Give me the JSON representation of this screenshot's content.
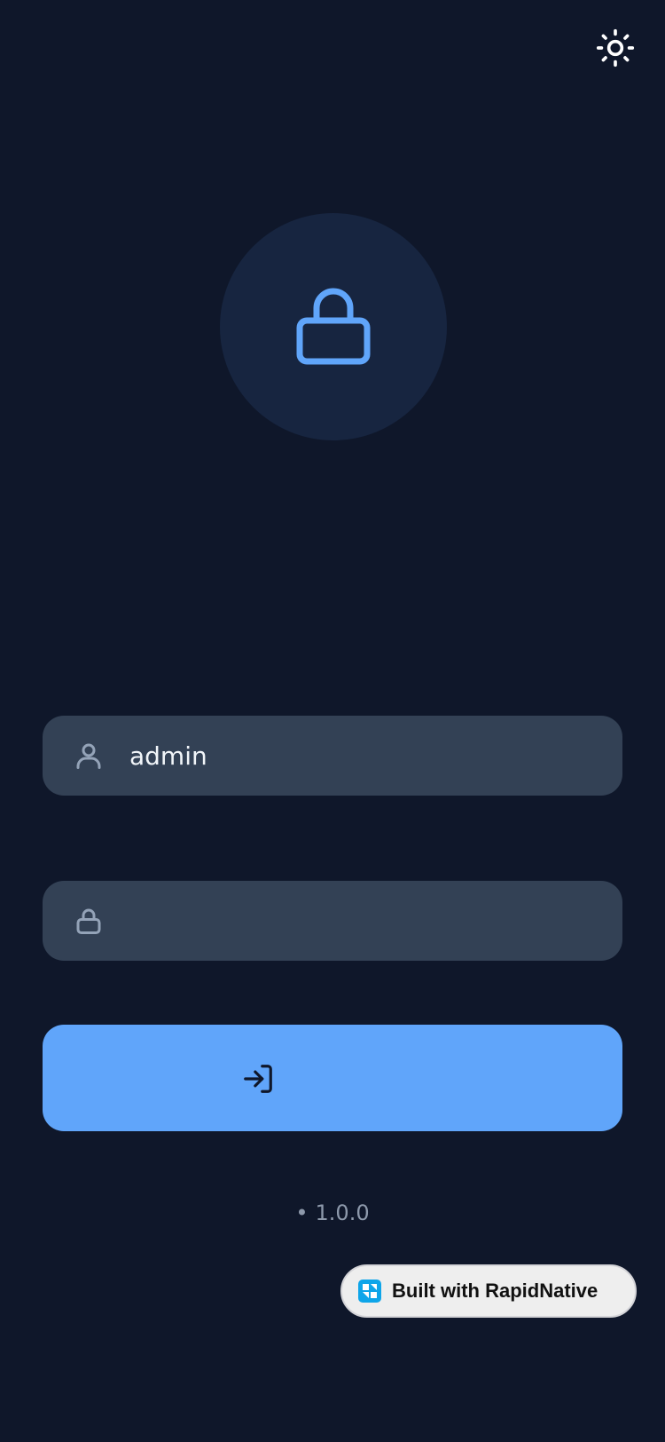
{
  "header": {
    "theme_toggle_icon": "sun-icon"
  },
  "hero": {
    "icon": "lock-icon",
    "accent_color": "#60a5fa",
    "circle_color": "#172540"
  },
  "form": {
    "username": {
      "icon": "user-icon",
      "value": "admin",
      "placeholder": ""
    },
    "password": {
      "icon": "lock-icon",
      "value": "",
      "placeholder": ""
    },
    "login_button": {
      "icon": "log-in-icon",
      "label": "",
      "color": "#60a5fa"
    }
  },
  "footer": {
    "separator": "•",
    "version": "1.0.0"
  },
  "badge": {
    "label": "Built with RapidNative",
    "logo": "rapidnative-logo"
  },
  "colors": {
    "background": "#0f172a",
    "field_background": "#334155",
    "muted_text": "#94a3b8"
  }
}
